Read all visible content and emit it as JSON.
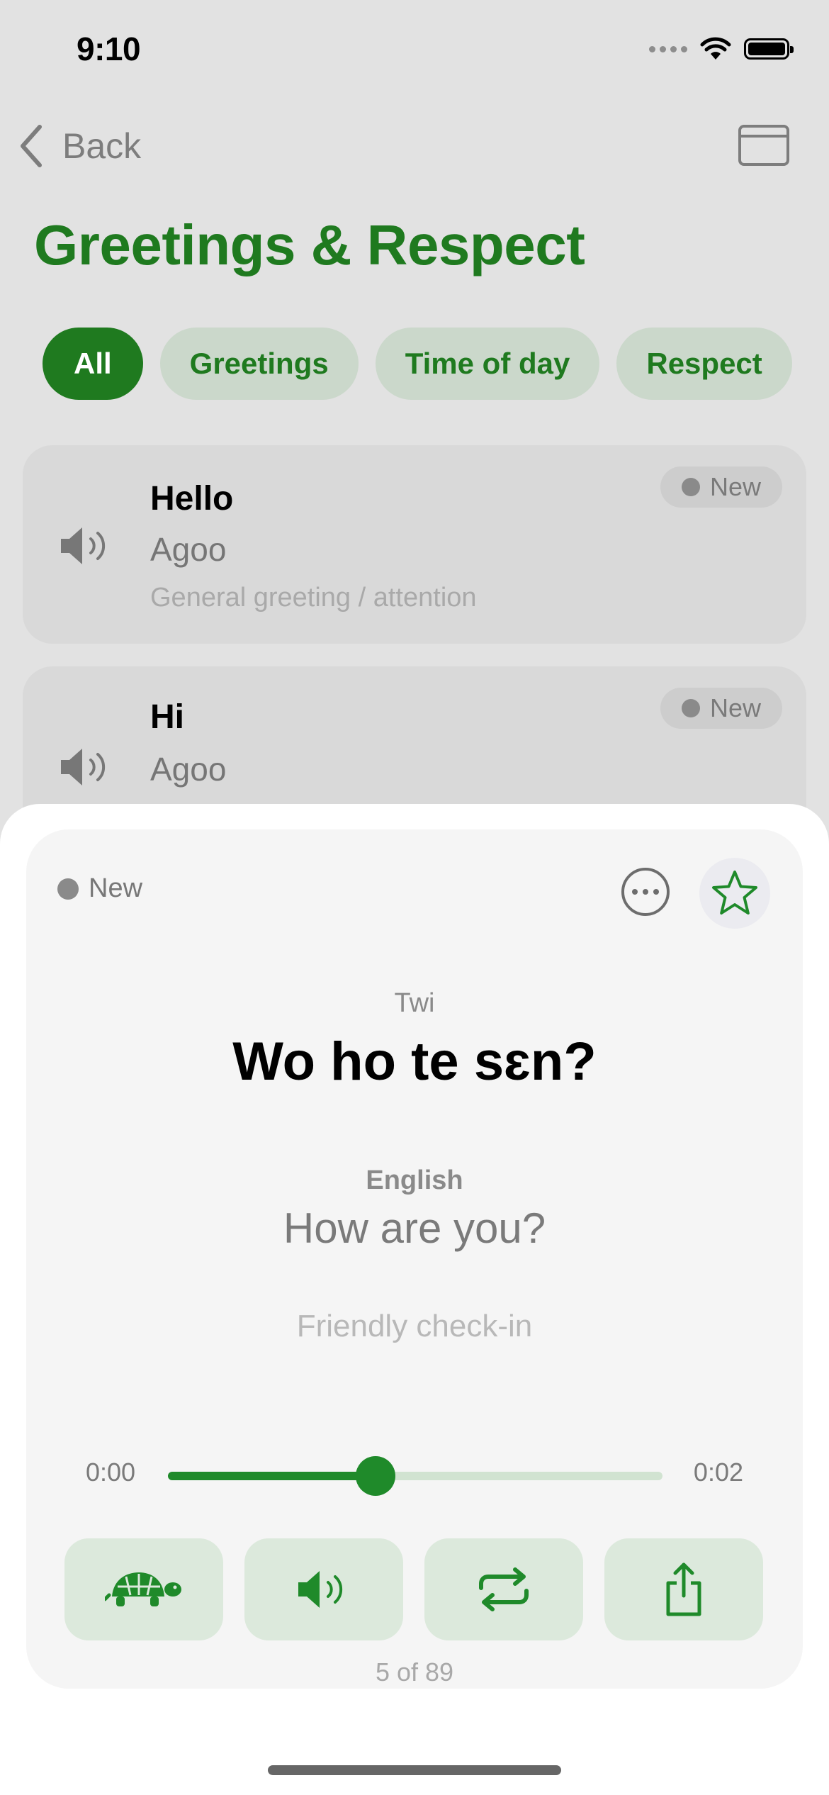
{
  "status": {
    "time": "9:10"
  },
  "nav": {
    "back_label": "Back"
  },
  "page": {
    "title": "Greetings & Respect"
  },
  "filters": [
    {
      "label": "All",
      "active": true
    },
    {
      "label": "Greetings",
      "active": false
    },
    {
      "label": "Time of day",
      "active": false
    },
    {
      "label": "Respect",
      "active": false
    }
  ],
  "list": [
    {
      "english": "Hello",
      "twi": "Agoo",
      "note": "General greeting / attention",
      "badge": "New"
    },
    {
      "english": "Hi",
      "twi": "Agoo",
      "badge": "New"
    }
  ],
  "card": {
    "badge": "New",
    "source_lang": "Twi",
    "source_text": "Wo ho te sɛn?",
    "target_lang": "English",
    "target_text": "How are you?",
    "context": "Friendly check-in",
    "time_start": "0:00",
    "time_end": "0:02",
    "progress": 0.42,
    "counter": "5 of 89"
  },
  "icons": {
    "back": "chevron-left-icon",
    "window": "window-icon",
    "speaker": "speaker-icon",
    "more": "ellipsis-circle-icon",
    "favorite": "star-icon",
    "slow": "turtle-icon",
    "play": "speaker-wave-icon",
    "repeat": "repeat-icon",
    "share": "share-icon"
  },
  "colors": {
    "accent": "#1f7a1f",
    "chip_bg": "#cbd8cb",
    "control_bg": "#dce9dc"
  }
}
